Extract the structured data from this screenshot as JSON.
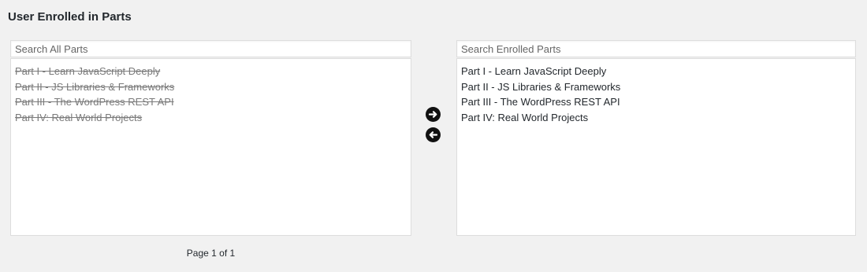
{
  "section": {
    "title": "User Enrolled in Parts"
  },
  "all_parts": {
    "search_placeholder": "Search All Parts",
    "items": [
      "Part I - Learn JavaScript Deeply",
      "Part II - JS Libraries & Frameworks",
      "Part III - The WordPress REST API",
      "Part IV: Real World Projects"
    ],
    "pagination": "Page 1 of 1"
  },
  "enrolled_parts": {
    "search_placeholder": "Search Enrolled Parts",
    "items": [
      "Part I - Learn JavaScript Deeply",
      "Part II - JS Libraries & Frameworks",
      "Part III - The WordPress REST API",
      "Part IV: Real World Projects"
    ]
  },
  "controls": {
    "add_icon": "arrow-right-circle-icon",
    "remove_icon": "arrow-left-circle-icon"
  },
  "colors": {
    "background": "#f1f1f1",
    "disabled_text": "#7a7a7a",
    "icon": "#111111"
  }
}
